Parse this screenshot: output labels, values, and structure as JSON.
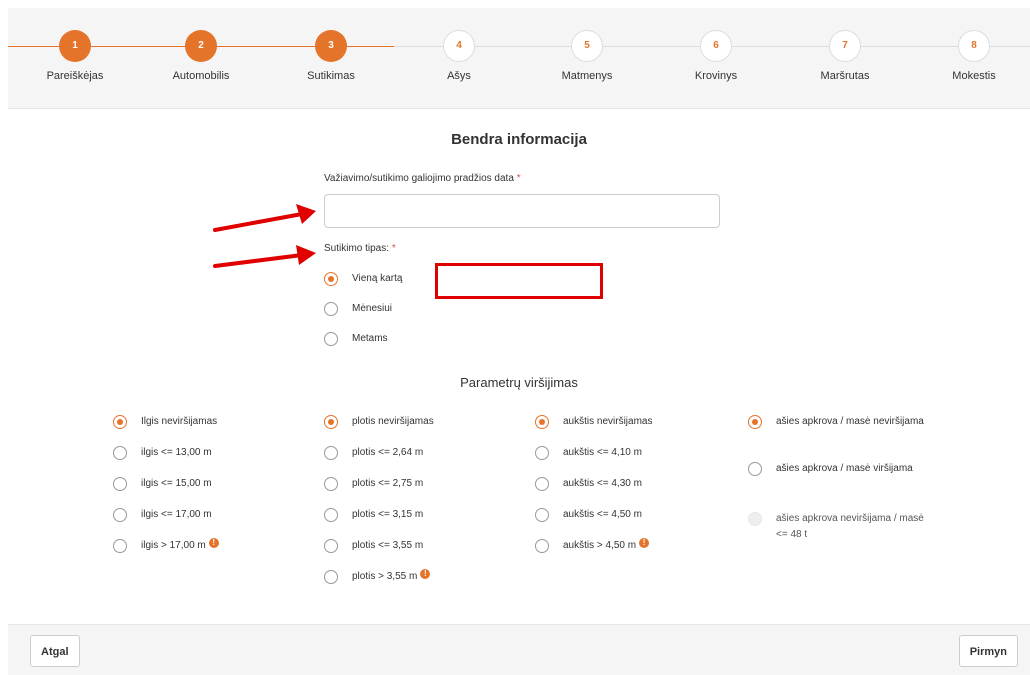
{
  "steps": [
    {
      "num": "1",
      "label": "Pareiškėjas",
      "state": "done"
    },
    {
      "num": "2",
      "label": "Automobilis",
      "state": "done"
    },
    {
      "num": "3",
      "label": "Sutikimas",
      "state": "done"
    },
    {
      "num": "4",
      "label": "Ašys",
      "state": "todo"
    },
    {
      "num": "5",
      "label": "Matmenys",
      "state": "todo"
    },
    {
      "num": "6",
      "label": "Krovinys",
      "state": "todo"
    },
    {
      "num": "7",
      "label": "Maršrutas",
      "state": "todo"
    },
    {
      "num": "8",
      "label": "Mokestis",
      "state": "todo"
    }
  ],
  "general": {
    "title": "Bendra informacija",
    "date_label": "Važiavimo/sutikimo galiojimo pradžios data",
    "date_value": "",
    "type_label": "Sutikimo tipas:",
    "required_mark": "*",
    "type_options": [
      "Vieną kartą",
      "Mėnesiui",
      "Metams"
    ],
    "type_selected": 0
  },
  "params": {
    "title": "Parametrų viršijimas",
    "length": [
      "Ilgis neviršijamas",
      "ilgis <= 13,00 m",
      "ilgis <= 15,00 m",
      "ilgis <= 17,00 m",
      "ilgis > 17,00 m"
    ],
    "width": [
      "plotis neviršijamas",
      "plotis <= 2,64 m",
      "plotis <= 2,75 m",
      "plotis <= 3,15 m",
      "plotis <= 3,55 m",
      "plotis > 3,55 m"
    ],
    "height": [
      "aukštis neviršijamas",
      "aukštis <= 4,10 m",
      "aukštis <= 4,30 m",
      "aukštis <= 4,50 m",
      "aukštis > 4,50 m"
    ],
    "axle": [
      "ašies apkrova / masė neviršijama",
      "ašies apkrova / masė viršijama",
      "ašies apkrova neviršijama / masė <= 48 t"
    ],
    "info_glyph": "!"
  },
  "buttons": {
    "back": "Atgal",
    "next": "Pirmyn"
  },
  "colors": {
    "accent": "#e5742b",
    "annotation": "#e00000"
  }
}
